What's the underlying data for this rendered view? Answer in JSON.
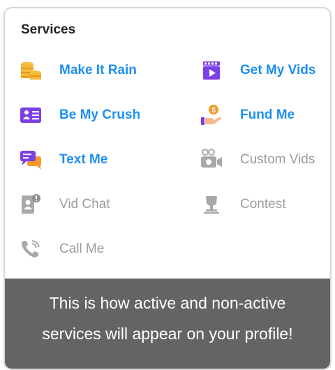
{
  "section_title": "Services",
  "services": {
    "make_it_rain": {
      "label": "Make It Rain",
      "active": true,
      "icon": "coins-icon"
    },
    "get_my_vids": {
      "label": "Get My Vids",
      "active": true,
      "icon": "video-play-icon"
    },
    "be_my_crush": {
      "label": "Be My Crush",
      "active": true,
      "icon": "profile-card-icon"
    },
    "fund_me": {
      "label": "Fund Me",
      "active": true,
      "icon": "hand-coin-icon"
    },
    "text_me": {
      "label": "Text Me",
      "active": true,
      "icon": "chat-bubbles-icon"
    },
    "custom_vids": {
      "label": "Custom Vids",
      "active": false,
      "icon": "video-camera-icon"
    },
    "vid_chat": {
      "label": "Vid Chat",
      "active": false,
      "icon": "video-chat-alert-icon"
    },
    "contest": {
      "label": "Contest",
      "active": false,
      "icon": "trophy-icon"
    },
    "call_me": {
      "label": "Call Me",
      "active": false,
      "icon": "phone-call-icon"
    }
  },
  "tooltip": {
    "line1": "This is how active and non-active",
    "line2": "services will appear on your profile!"
  },
  "colors": {
    "active_label": "#1f8ff0",
    "inactive_label": "#9c9c9c",
    "tooltip_bg": "#646464",
    "coin_gold": "#f5b93a",
    "purple": "#7b3fe4",
    "orange": "#f49a2b"
  }
}
